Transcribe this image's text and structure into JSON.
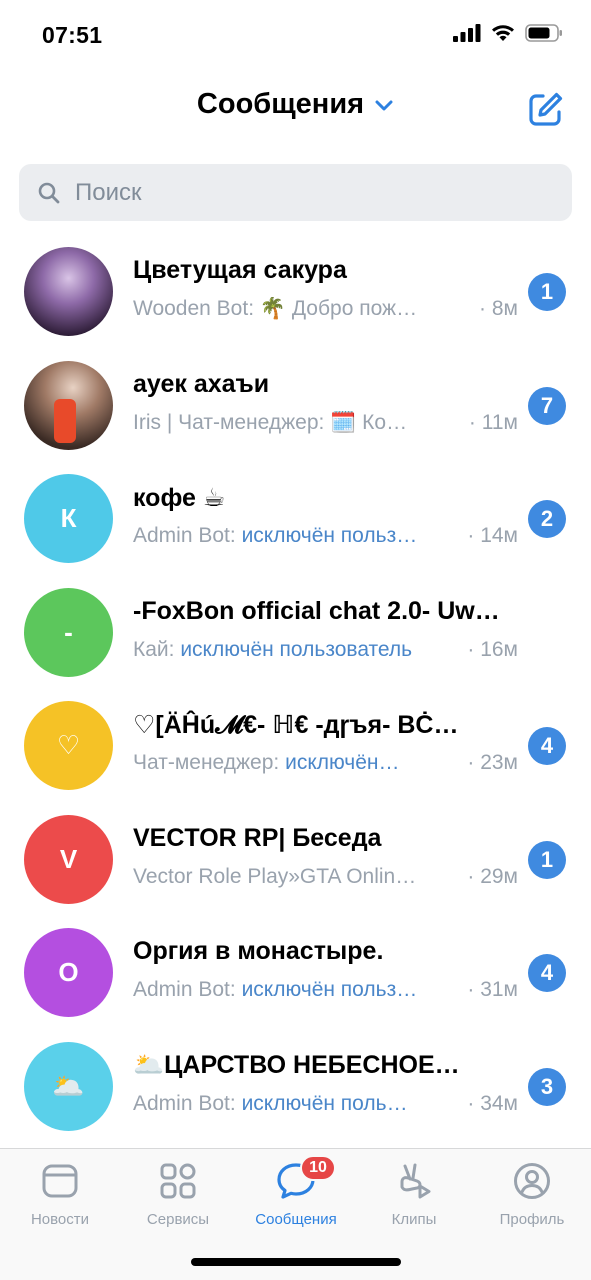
{
  "status_bar": {
    "time": "07:51"
  },
  "header": {
    "title": "Сообщения"
  },
  "search": {
    "placeholder": "Поиск"
  },
  "chats": [
    {
      "title": "Цветущая сакура",
      "sender": "Wooden Bot: 🌴 Добро пож…",
      "action": "",
      "time": "· 8м",
      "unread": "1",
      "avatar_text": "",
      "avatar_color": "#6b4a7c",
      "avatar_kind": "photo-anime"
    },
    {
      "title": "ауек ахаъи",
      "sender": "Iris | Чат-менеджер: 🗓️ Ко…",
      "action": "",
      "time": "· 11м",
      "unread": "7",
      "avatar_text": "",
      "avatar_color": "#7a5a4a",
      "avatar_kind": "photo-person"
    },
    {
      "title": "кофе ☕",
      "sender": "Admin Bot: ",
      "action": "исключён польз…",
      "time": "· 14м",
      "unread": "2",
      "avatar_text": "К",
      "avatar_color": "#4fc9e8"
    },
    {
      "title": "-FoxBon official chat 2.0- Uw…",
      "sender": "Кай: ",
      "action": "исключён пользователь",
      "time": "· 16м",
      "unread": "",
      "avatar_text": "-",
      "avatar_color": "#5cc75c"
    },
    {
      "title": "♡[ÄĤú𝓜€- ℍ€ -дɼъя- ВĊ…",
      "sender": "Чат-менеджер: ",
      "action": "исключён…",
      "time": "· 23м",
      "unread": "4",
      "avatar_text": "♡",
      "avatar_color": "#f5c226"
    },
    {
      "title": "VECTOR RP| Беседа",
      "sender": "Vector Role Play»GTA Onlin…",
      "action": "",
      "time": "· 29м",
      "unread": "1",
      "avatar_text": "V",
      "avatar_color": "#ec4b4b"
    },
    {
      "title": "Оргия в монастыре.",
      "sender": "Admin Bot: ",
      "action": "исключён польз…",
      "time": "· 31м",
      "unread": "4",
      "avatar_text": "О",
      "avatar_color": "#b44fe0"
    },
    {
      "title": "🌥️ЦАРСТВО НЕБЕСНОЕ…",
      "sender": "Admin Bot: ",
      "action": "исключён поль…",
      "time": "· 34м",
      "unread": "3",
      "avatar_text": "🌥️",
      "avatar_color": "#5ad0ea"
    }
  ],
  "tabbar": {
    "tabs": [
      {
        "label": "Новости",
        "icon": "news-icon"
      },
      {
        "label": "Сервисы",
        "icon": "services-icon"
      },
      {
        "label": "Сообщения",
        "icon": "messages-icon",
        "badge": "10",
        "active": true
      },
      {
        "label": "Клипы",
        "icon": "clips-icon"
      },
      {
        "label": "Профиль",
        "icon": "profile-icon"
      }
    ]
  },
  "colors": {
    "accent": "#2d81e0",
    "unread": "#3f8ae0",
    "badge": "#e64646",
    "muted": "#99a2ad"
  }
}
